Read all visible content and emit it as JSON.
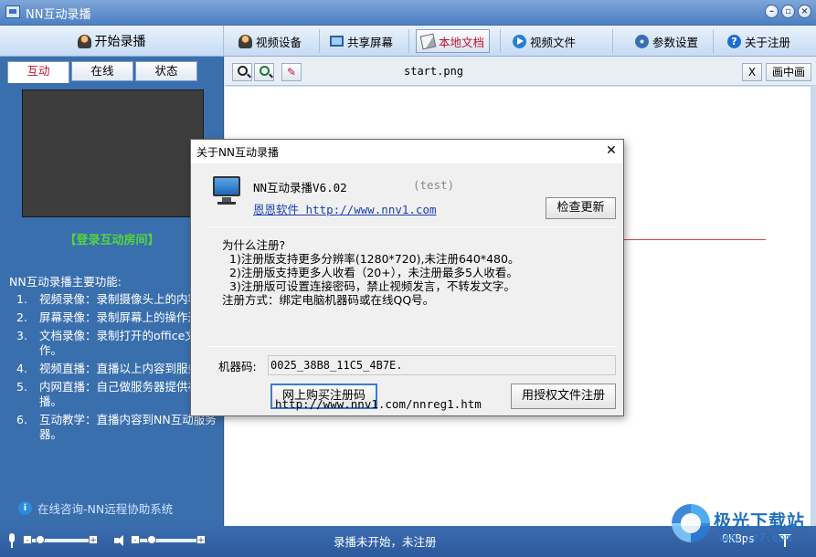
{
  "window": {
    "title": "NN互动录播",
    "controls": [
      "minimize-icon",
      "restore-icon",
      "close-icon"
    ]
  },
  "toolbar": {
    "start_record": "开始录播",
    "buttons": [
      {
        "label": "视频设备",
        "icon": "user-icon"
      },
      {
        "label": "共享屏幕",
        "icon": "screen-icon"
      },
      {
        "label": "本地文档",
        "icon": "document-icon",
        "active": true
      },
      {
        "label": "视频文件",
        "icon": "play-icon"
      },
      {
        "label": "参数设置",
        "icon": "gear-icon"
      },
      {
        "label": "关于注册",
        "icon": "help-icon"
      }
    ]
  },
  "left_panel": {
    "tabs": [
      {
        "label": "互动",
        "active": true
      },
      {
        "label": "在线"
      },
      {
        "label": "状态"
      }
    ],
    "login_room": "【登录互动房间】",
    "features_title": "NN互动录播主要功能:",
    "features": [
      {
        "num": "1.",
        "text": "视频录像：录制摄像头上的内容。"
      },
      {
        "num": "2.",
        "text": "屏幕录像：录制屏幕上的操作过程。"
      },
      {
        "num": "3.",
        "text": "文档录像：录制打开的office文档操作。"
      },
      {
        "num": "4.",
        "text": "视频直播：直播以上内容到服务器。"
      },
      {
        "num": "5.",
        "text": "内网直播：自己做服务器提供视频直播。"
      },
      {
        "num": "6.",
        "text": "互动教学：直播内容到NN互动服务器。"
      }
    ],
    "consult": "在线咨询-NN远程协助系统"
  },
  "document": {
    "zoom_in": "zoom-in-icon",
    "zoom_out": "zoom-out-icon",
    "pen": "pen-icon",
    "filename": "start.png",
    "close_label": "X",
    "pip_label": "画中画"
  },
  "status_bar": {
    "mic_level": 0.08,
    "speaker_level": 0.15,
    "record_status": "录播未开始，未注册",
    "speed": "0KBps"
  },
  "watermark": {
    "text": "极光下载站",
    "url": "www.xz7.com"
  },
  "dialog": {
    "title": "关于NN互动录播",
    "close_label": "✕",
    "product": "NN互动录播V6.02",
    "test": "(test)",
    "company_link": "恩恩软件 http://www.nnv1.com",
    "check_update": "检查更新",
    "why_title": "为什么注册?",
    "reasons": [
      "1)注册版支持更多分辨率(1280*720),未注册640*480。",
      "2)注册版支持更多人收看（20+），未注册最多5人收看。",
      "3)注册版可设置连接密码，禁止视频发言，不转发文字。"
    ],
    "reg_method": "注册方式：绑定电脑机器码或在线QQ号。",
    "machine_label": "机器码:",
    "machine_code": "0025_38B8_11C5_4B7E.",
    "buy_button": "网上购买注册码",
    "license_button": "用授权文件注册",
    "reg_url": "http://www.nnv1.com/nnreg1.htm"
  }
}
